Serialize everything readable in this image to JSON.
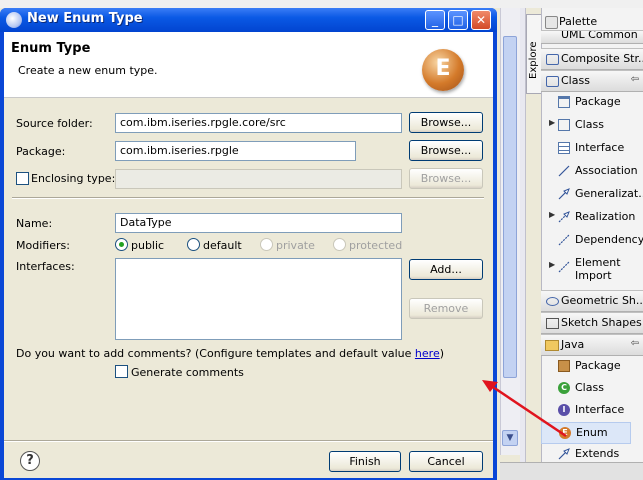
{
  "dialog": {
    "title": "New Enum Type",
    "header_title": "Enum Type",
    "header_desc": "Create a new enum type.",
    "header_icon_letter": "E",
    "source_folder_label": "Source folder:",
    "source_folder_value": "com.ibm.iseries.rpgle.core/src",
    "package_label": "Package:",
    "package_value": "com.ibm.iseries.rpgle",
    "enclosing_label": "Enclosing type:",
    "enclosing_value": "",
    "browse_label": "Browse...",
    "name_label": "Name:",
    "name_value": "DataType",
    "modifiers_label": "Modifiers:",
    "modifiers": [
      "public",
      "default",
      "private",
      "protected"
    ],
    "modifier_selected": "public",
    "interfaces_label": "Interfaces:",
    "add_label": "Add...",
    "remove_label": "Remove",
    "comments_prompt": "Do you want to add comments? (Configure templates and default value ",
    "comments_link": "here",
    "comments_close": ")",
    "generate_comments_label": "Generate comments",
    "help_label": "?",
    "finish_label": "Finish",
    "cancel_label": "Cancel"
  },
  "window_buttons": {
    "minimize": "_",
    "maximize": "□",
    "close": "✕"
  },
  "side": {
    "explore_tab": "Explore",
    "palette_title": "Palette"
  },
  "palette": {
    "drawers": {
      "uml_common": "UML Common",
      "composite": "Composite Str...",
      "class": "Class",
      "geometric": "Geometric Sh...",
      "sketch": "Sketch Shapes",
      "java": "Java"
    },
    "class_items": [
      "Package",
      "Class",
      "Interface",
      "Association",
      "Generalizat...",
      "Realization",
      "Dependency",
      "Element",
      "Import"
    ],
    "java_items": [
      "Package",
      "Class",
      "Interface",
      "Enum",
      "Extends"
    ]
  },
  "colors": {
    "titlebar": "#0a59e5",
    "dialog_bg": "#ece9d8",
    "arrow": "#e0141e",
    "enum_icon": "#d47a2a"
  }
}
